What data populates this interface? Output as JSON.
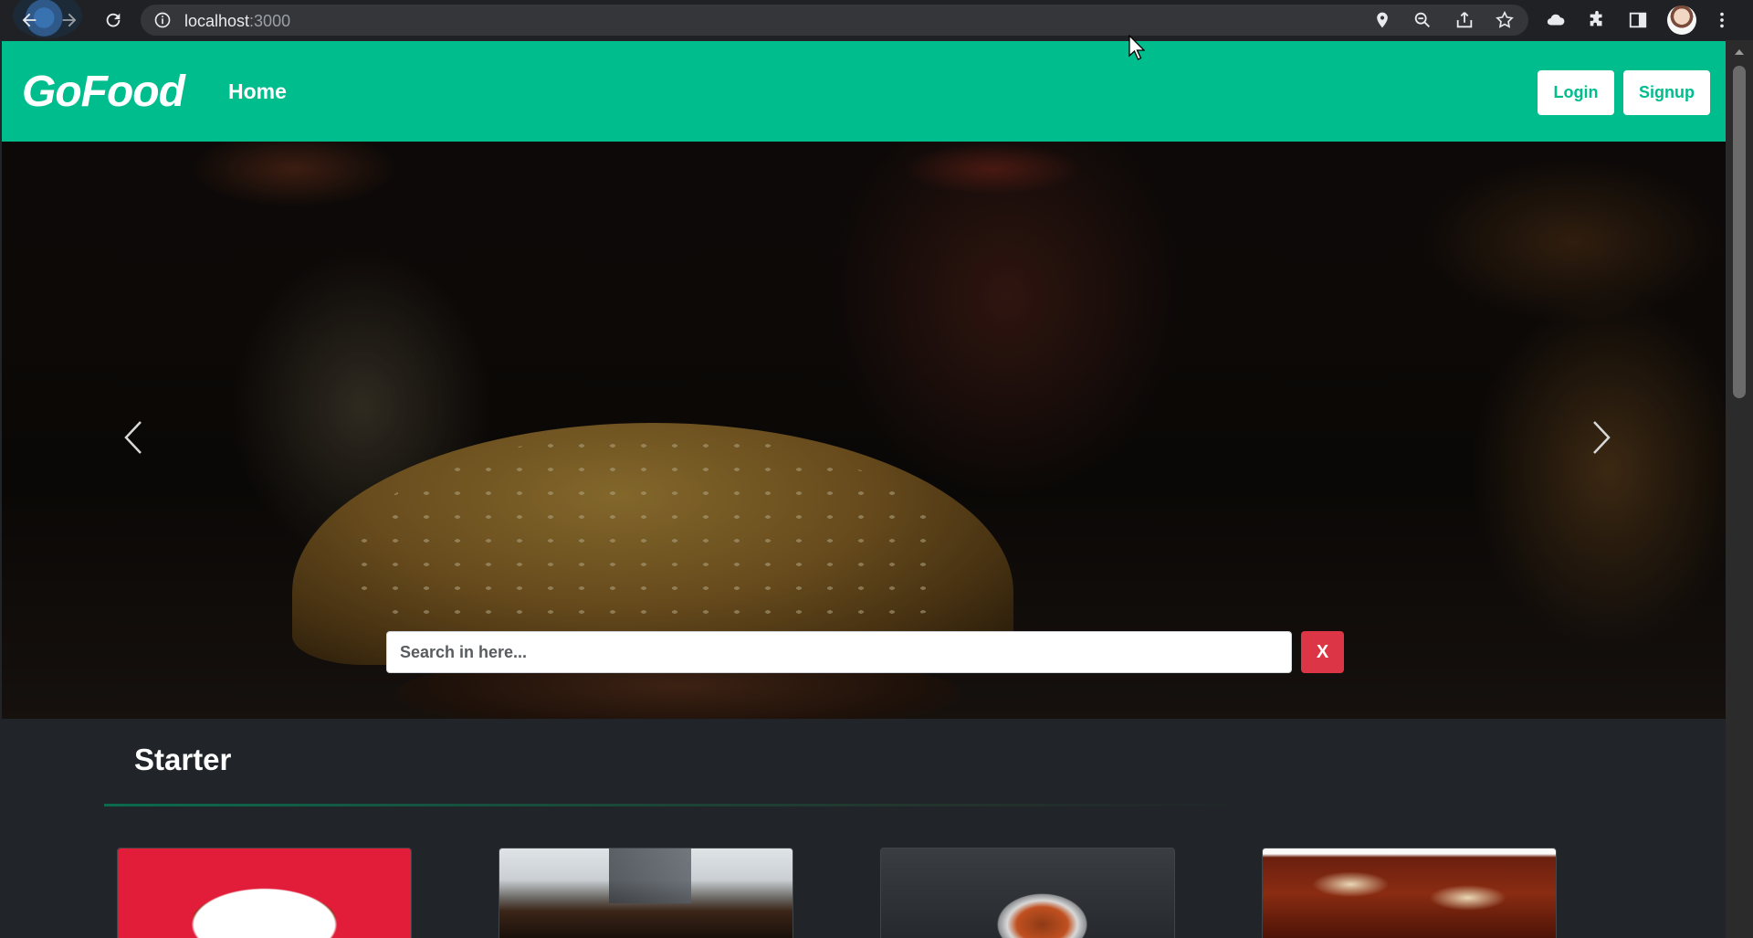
{
  "browser": {
    "url_host": "localhost",
    "url_port": ":3000",
    "icons": [
      "back-icon",
      "forward-icon",
      "reload-icon",
      "info-icon",
      "location-icon",
      "zoom-icon",
      "share-icon",
      "bookmark-star-icon",
      "extension-cloud-icon",
      "extensions-puzzle-icon",
      "side-panel-icon",
      "profile-avatar",
      "menu-kebab-icon"
    ]
  },
  "navbar": {
    "brand": "GoFood",
    "home_label": "Home",
    "login_label": "Login",
    "signup_label": "Signup",
    "color": "#00bd8e"
  },
  "carousel": {
    "search_placeholder": "Search in here...",
    "search_value": "",
    "clear_label": "X",
    "clear_color": "#dc3545"
  },
  "categories": [
    {
      "title": "Starter",
      "cards": [
        {
          "image": "chilli-paneer-bowl"
        },
        {
          "image": "grilled-skewers"
        },
        {
          "image": "paneer-tikka-plate"
        },
        {
          "image": "chilli-chicken"
        }
      ]
    }
  ]
}
